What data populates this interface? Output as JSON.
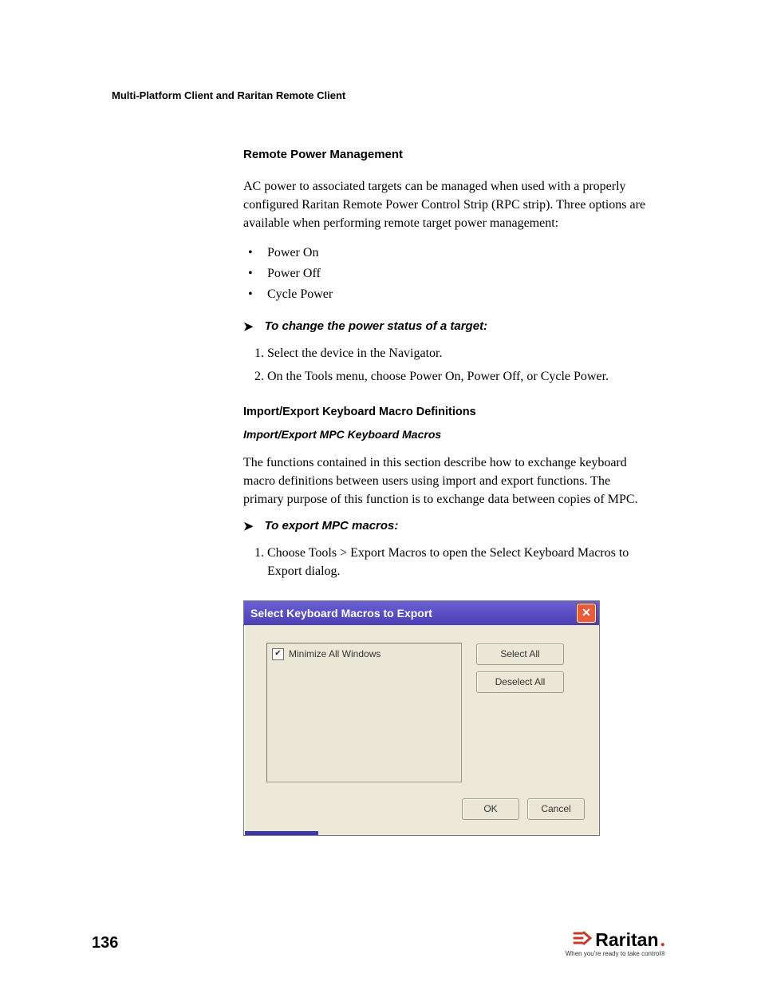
{
  "header": "Multi-Platform Client and Raritan Remote Client",
  "section1": {
    "title": "Remote Power Management",
    "para": "AC power to associated targets can be managed when used with a properly configured Raritan Remote Power Control Strip (RPC strip). Three options are available when performing remote target power management:",
    "bullets": [
      "Power On",
      "Power Off",
      "Cycle Power"
    ],
    "proc_title": "To change the power status of a target:",
    "steps": [
      "Select the device in the Navigator.",
      "On the Tools menu, choose Power On, Power Off, or Cycle Power."
    ]
  },
  "section2": {
    "h3": "Import/Export Keyboard Macro Definitions",
    "h4": "Import/Export MPC Keyboard Macros",
    "para": "The functions contained in this section describe how to exchange keyboard macro definitions between users using import and export functions. The primary purpose of this function is to exchange data between copies of MPC.",
    "proc_title": "To export MPC macros:",
    "steps": [
      "Choose Tools > Export Macros to open the Select Keyboard Macros to Export dialog."
    ]
  },
  "dialog": {
    "title": "Select Keyboard Macros to Export",
    "close": "✕",
    "item": "Minimize All Windows",
    "checked": "✔",
    "select_all": "Select All",
    "deselect_all": "Deselect All",
    "ok": "OK",
    "cancel": "Cancel"
  },
  "footer": {
    "page": "136",
    "brand": "Raritan",
    "tagline": "When you're ready to take control®"
  }
}
